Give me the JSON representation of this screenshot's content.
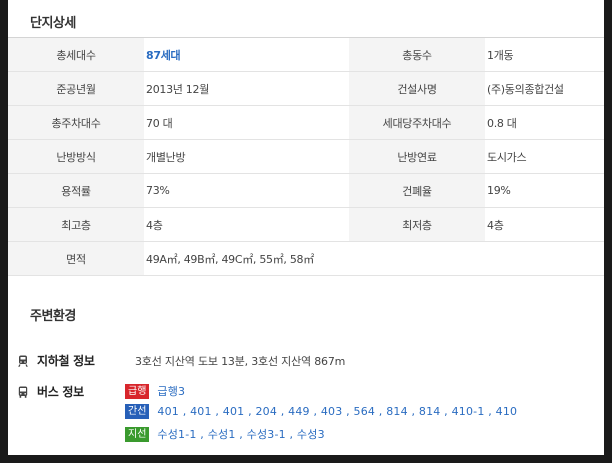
{
  "detail": {
    "title": "단지상세",
    "rows": [
      [
        {
          "label": "총세대수",
          "value": "87세대",
          "highlight": true
        },
        {
          "label": "총동수",
          "value": "1개동"
        }
      ],
      [
        {
          "label": "준공년월",
          "value": "2013년 12월"
        },
        {
          "label": "건설사명",
          "value": "(주)동의종합건설"
        }
      ],
      [
        {
          "label": "총주차대수",
          "value": "70 대"
        },
        {
          "label": "세대당주차대수",
          "value": "0.8 대"
        }
      ],
      [
        {
          "label": "난방방식",
          "value": "개별난방"
        },
        {
          "label": "난방연료",
          "value": "도시가스"
        }
      ],
      [
        {
          "label": "용적률",
          "value": "73%"
        },
        {
          "label": "건폐율",
          "value": "19%"
        }
      ],
      [
        {
          "label": "최고층",
          "value": "4층"
        },
        {
          "label": "최저층",
          "value": "4층"
        }
      ],
      [
        {
          "label": "면적",
          "value": "49A㎡, 49B㎡, 49C㎡, 55㎡, 58㎡"
        }
      ]
    ]
  },
  "environment": {
    "title": "주변환경",
    "subway": {
      "label": "지하철 정보",
      "text": "3호선 지산역 도보 13분, 3호선 지산역 867m"
    },
    "bus": {
      "label": "버스 정보",
      "lines": [
        {
          "badge": "급행",
          "color": "#d8262c",
          "routes": "급행3"
        },
        {
          "badge": "간선",
          "color": "#2760b8",
          "routes": "401 , 401 , 401 , 204 , 449 , 403 , 564 , 814 , 814 , 410-1 , 410"
        },
        {
          "badge": "지선",
          "color": "#3a9a2e",
          "routes": "수성1-1 , 수성1 , 수성3-1 , 수성3"
        }
      ]
    }
  }
}
